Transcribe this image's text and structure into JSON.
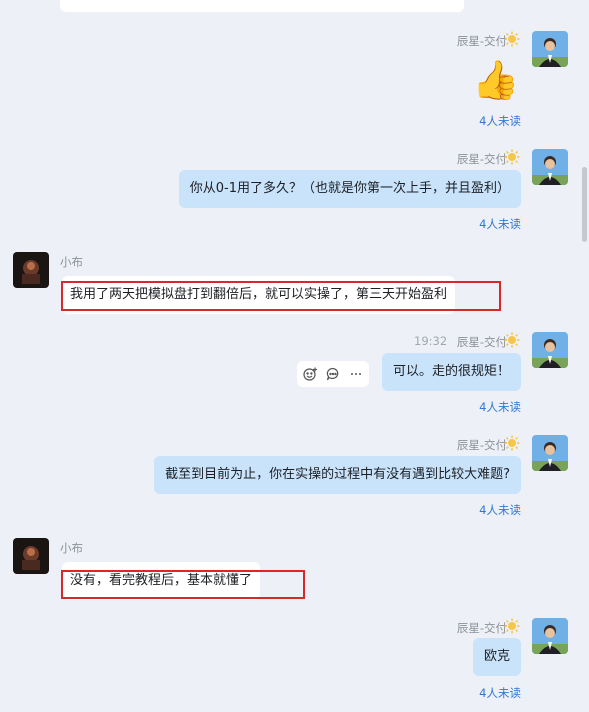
{
  "messages": [
    {
      "type": "out-emoji",
      "sender": "辰星-交付",
      "emoji": "👍",
      "unread": "4人未读"
    },
    {
      "type": "out",
      "sender": "辰星-交付",
      "text": "你从0-1用了多久？（也就是你第一次上手，并且盈利）",
      "unread": "4人未读"
    },
    {
      "type": "in",
      "sender": "小布",
      "text": "我用了两天把模拟盘打到翻倍后，就可以实操了，第三天开始盈利"
    },
    {
      "type": "out",
      "sender": "辰星-交付",
      "time": "19:32",
      "text": "可以。走的很规矩！",
      "unread": "4人未读"
    },
    {
      "type": "out",
      "sender": "辰星-交付",
      "text": "截至到目前为止，你在实操的过程中有没有遇到比较大难题?",
      "unread": "4人未读"
    },
    {
      "type": "in",
      "sender": "小布",
      "text": "没有，看完教程后，基本就懂了"
    },
    {
      "type": "out",
      "sender": "辰星-交付",
      "text": "欧克",
      "unread": "4人未读"
    }
  ],
  "colors": {
    "accent": "#2f78d6",
    "highlight": "#d9282b",
    "bubble_out": "#c9e3fb"
  },
  "icons": {
    "sender_badge": "sun-badge-icon",
    "toolbar": [
      "emoji-reaction-icon",
      "comment-icon",
      "more-icon"
    ]
  }
}
